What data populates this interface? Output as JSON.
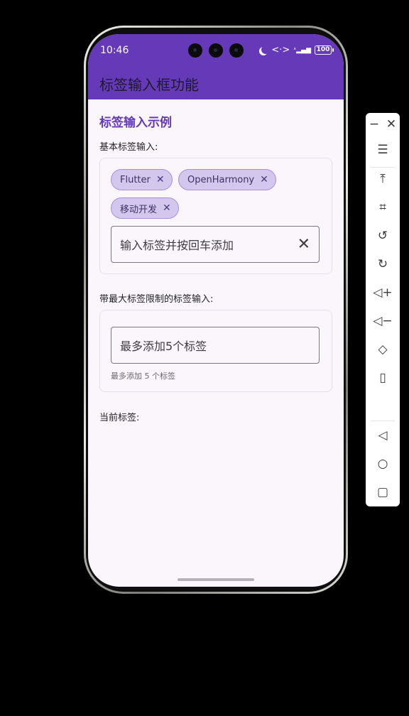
{
  "status_bar": {
    "time": "10:46",
    "network": "<·>",
    "signal": "ˣ▂▄▆",
    "battery": "100"
  },
  "app_bar": {
    "title": "标签输入框功能"
  },
  "page": {
    "section_title": "标签输入示例",
    "basic": {
      "label": "基本标签输入:",
      "tags": [
        "Flutter",
        "OpenHarmony",
        "移动开发"
      ],
      "input_placeholder": "输入标签并按回车添加"
    },
    "limited": {
      "label": "带最大标签限制的标签输入:",
      "input_placeholder": "最多添加5个标签",
      "helper_text": "最多添加 5 个标签"
    },
    "current_tags_label": "当前标签:"
  },
  "colors": {
    "primary": "#6639b8",
    "chip_background": "#d3c7ee",
    "surface": "#fbf6fc"
  },
  "toolbar_icons": [
    "minimize-icon",
    "close-icon",
    "menu-icon",
    "pin-top-icon",
    "crop-icon",
    "rotate-left-icon",
    "rotate-right-icon",
    "volume-up-icon",
    "volume-down-icon",
    "shake-icon",
    "screen-share-icon",
    "back-icon",
    "home-icon",
    "recents-icon"
  ]
}
